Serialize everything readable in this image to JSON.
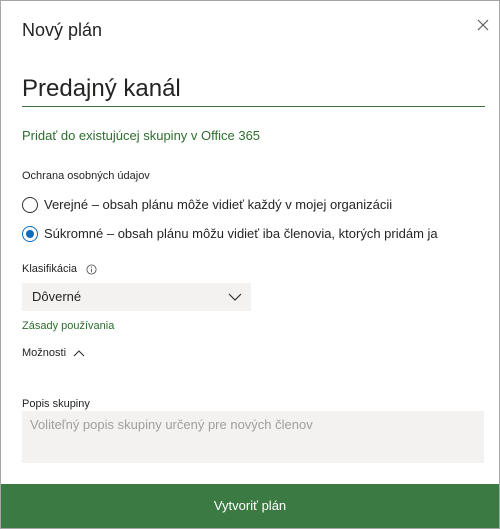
{
  "dialog": {
    "title": "Nový plán",
    "close_icon": "close-icon"
  },
  "plan_name": {
    "value": "Predajný kanál"
  },
  "add_to_group_link": "Pridať do existujúcej skupiny v Office 365",
  "privacy": {
    "label": "Ochrana osobných údajov",
    "options": [
      {
        "label": "Verejné – obsah plánu môže vidieť každý v mojej organizácii",
        "selected": false
      },
      {
        "label": "Súkromné – obsah plánu môžu vidieť iba členovia, ktorých pridám ja",
        "selected": true
      }
    ]
  },
  "classification": {
    "label": "Klasifikácia",
    "info_icon": "info-icon",
    "selected": "Dôverné",
    "chevron_icon": "chevron-down-icon"
  },
  "usage_policy_link": "Zásady používania",
  "options_toggle": {
    "label": "Možnosti",
    "icon": "chevron-up-icon"
  },
  "group_description": {
    "label": "Popis skupiny",
    "placeholder": "Voliteľný popis skupiny určený pre nových členov",
    "value": ""
  },
  "create_button": {
    "label": "Vytvoriť plán"
  },
  "colors": {
    "accent_green": "#3b7a42",
    "link_green": "#2d6e2d",
    "radio_blue": "#0f6cbd",
    "field_background": "#f3f2f1"
  }
}
